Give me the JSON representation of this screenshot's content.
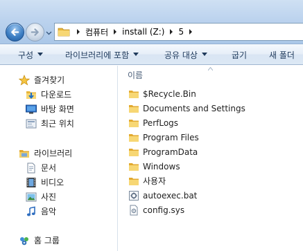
{
  "address": {
    "segments": [
      "컴퓨터",
      "install (Z:)",
      "5"
    ]
  },
  "toolbar": {
    "organize": "구성",
    "include_in_library": "라이브러리에 포함",
    "share_with": "공유 대상",
    "burn": "굽기",
    "new_folder": "새 폴더"
  },
  "sidebar": {
    "favorites": {
      "label": "즐겨찾기",
      "items": [
        {
          "label": "다운로드",
          "icon": "download-folder-icon"
        },
        {
          "label": "바탕 화면",
          "icon": "desktop-icon"
        },
        {
          "label": "최근 위치",
          "icon": "recent-places-icon"
        }
      ]
    },
    "libraries": {
      "label": "라이브러리",
      "items": [
        {
          "label": "문서",
          "icon": "documents-icon"
        },
        {
          "label": "비디오",
          "icon": "videos-icon"
        },
        {
          "label": "사진",
          "icon": "pictures-icon"
        },
        {
          "label": "음악",
          "icon": "music-icon"
        }
      ]
    },
    "homegroup": {
      "label": "홈 그룹"
    }
  },
  "content": {
    "column_header": "이름",
    "files": [
      {
        "name": "$Recycle.Bin",
        "type": "folder"
      },
      {
        "name": "Documents and Settings",
        "type": "folder"
      },
      {
        "name": "PerfLogs",
        "type": "folder"
      },
      {
        "name": "Program Files",
        "type": "folder"
      },
      {
        "name": "ProgramData",
        "type": "folder"
      },
      {
        "name": "Windows",
        "type": "folder"
      },
      {
        "name": "사용자",
        "type": "folder"
      },
      {
        "name": "autoexec.bat",
        "type": "batch"
      },
      {
        "name": "config.sys",
        "type": "system"
      }
    ]
  },
  "colors": {
    "folder_yellow": "#f2c94c",
    "command_text": "#1e395b",
    "header_text": "#4c607a"
  }
}
